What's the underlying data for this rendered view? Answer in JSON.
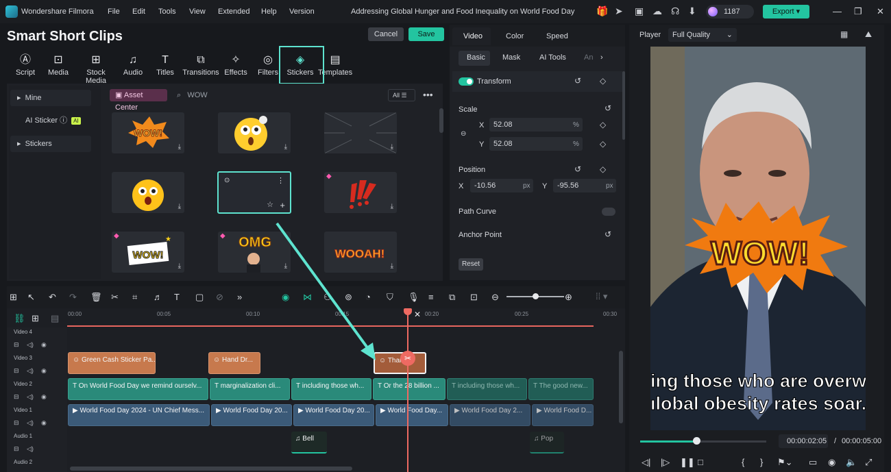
{
  "header": {
    "app_name": "Wondershare Filmora",
    "menu": [
      "File",
      "Edit",
      "Tools",
      "View",
      "Extended",
      "Help",
      "Version"
    ],
    "project_title": "Addressing Global Hunger and Food Inequality on World Food Day",
    "credits": "1187",
    "export_label": "Export"
  },
  "panel": {
    "title": "Smart Short Clips",
    "cancel": "Cancel",
    "save": "Save"
  },
  "tools": [
    {
      "label": "Script",
      "icon": "script-icon"
    },
    {
      "label": "Media",
      "icon": "media-icon"
    },
    {
      "label": "Stock Media",
      "icon": "stock-media-icon"
    },
    {
      "label": "Audio",
      "icon": "audio-icon"
    },
    {
      "label": "Titles",
      "icon": "titles-icon"
    },
    {
      "label": "Transitions",
      "icon": "transitions-icon"
    },
    {
      "label": "Effects",
      "icon": "effects-icon"
    },
    {
      "label": "Filters",
      "icon": "filters-icon"
    },
    {
      "label": "Stickers",
      "icon": "stickers-icon"
    },
    {
      "label": "Templates",
      "icon": "templates-icon"
    }
  ],
  "sidebar": {
    "items": [
      {
        "label": "Mine"
      },
      {
        "label": "AI Sticker",
        "badge": "AI"
      },
      {
        "label": "Stickers"
      }
    ]
  },
  "library": {
    "asset_center": "Asset Center",
    "search_value": "WOW",
    "filter_label": "All"
  },
  "stickers": [
    {
      "text": "WOW!"
    },
    {
      "text": ""
    },
    {
      "text": ""
    },
    {
      "text": ""
    },
    {
      "text": ""
    },
    {
      "text": ""
    },
    {
      "text": "WOW!"
    },
    {
      "text": "OMG"
    },
    {
      "text": "WOOAH!"
    }
  ],
  "properties": {
    "tabs": [
      "Video",
      "Color",
      "Speed"
    ],
    "subtabs": [
      "Basic",
      "Mask",
      "AI Tools",
      "An"
    ],
    "transform": "Transform",
    "scale_label": "Scale",
    "scale_x": "52.08",
    "scale_y": "52.08",
    "percent": "%",
    "position_label": "Position",
    "pos_x": "-10.56",
    "pos_y": "-95.56",
    "px": "px",
    "x_label": "X",
    "y_label": "Y",
    "path_curve": "Path Curve",
    "anchor_point": "Anchor Point",
    "reset": "Reset"
  },
  "player": {
    "label": "Player",
    "quality": "Full Quality",
    "subtitle_line1": "ing those who are overw",
    "subtitle_line2": "ılobal obesity rates soar.",
    "sticker_text": "WOW!",
    "current_time": "00:00:02:05",
    "separator": "/",
    "total_time": "00:00:05:00",
    "progress": 0.41
  },
  "timeline": {
    "ruler": [
      "00:00",
      "00:05",
      "00:10",
      "00:15",
      "00:20",
      "00:25",
      "00:30"
    ],
    "tracks": [
      "Video 4",
      "Video 3",
      "Video 2",
      "Video 1",
      "Audio 1",
      "Audio 2"
    ],
    "clips_v3": [
      "Green Cash Sticker Pa...",
      "Hand Dr...",
      "Than"
    ],
    "clips_v2": [
      "On World Food Day we remind ourselv...",
      "marginalization cli...",
      "including those wh...",
      "Or the 28 billion ...",
      "including those wh...",
      "The good new..."
    ],
    "clips_v1": [
      "World Food Day 2024 - UN Chief Mess...",
      "World Food Day 20...",
      "World Food Day 20...",
      "World Food Day...",
      "World Food Day 2...",
      "World Food D..."
    ],
    "clips_a1": [
      "Bell",
      "Pop"
    ]
  }
}
